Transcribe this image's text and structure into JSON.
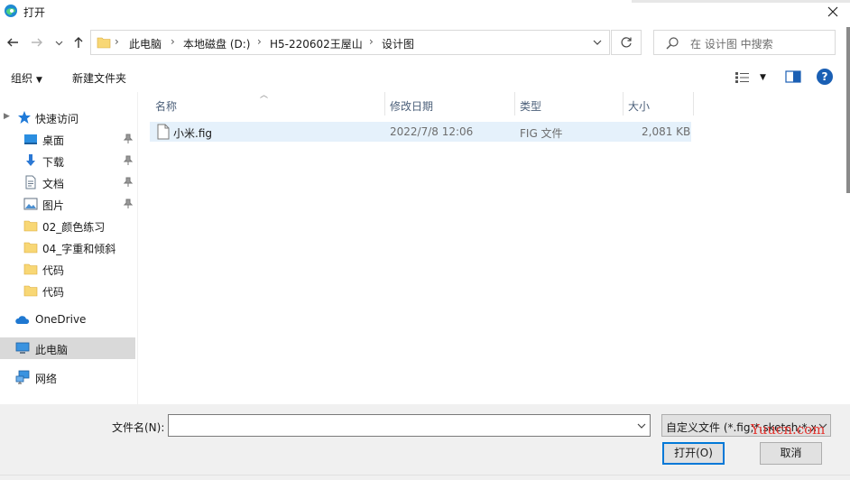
{
  "window": {
    "title": "打开"
  },
  "nav": {
    "breadcrumbs": [
      "此电脑",
      "本地磁盘 (D:)",
      "H5-220602王屋山",
      "设计图"
    ],
    "search_placeholder": "在 设计图 中搜索"
  },
  "toolbar": {
    "organize_label": "组织",
    "new_folder_label": "新建文件夹"
  },
  "sidebar": {
    "items": [
      {
        "label": "快速访问",
        "icon": "star-icon"
      },
      {
        "label": "桌面",
        "icon": "desktop-icon",
        "pinned": true
      },
      {
        "label": "下载",
        "icon": "download-icon",
        "pinned": true
      },
      {
        "label": "文档",
        "icon": "document-icon",
        "pinned": true
      },
      {
        "label": "图片",
        "icon": "picture-icon",
        "pinned": true
      },
      {
        "label": "02_颜色练习",
        "icon": "folder-icon"
      },
      {
        "label": "04_字重和倾斜",
        "icon": "folder-icon"
      },
      {
        "label": "代码",
        "icon": "folder-icon"
      },
      {
        "label": "代码",
        "icon": "folder-icon"
      },
      {
        "label": "OneDrive",
        "icon": "cloud-icon"
      },
      {
        "label": "此电脑",
        "icon": "computer-icon",
        "selected": true
      },
      {
        "label": "网络",
        "icon": "network-icon"
      }
    ]
  },
  "columns": {
    "name": "名称",
    "modified": "修改日期",
    "type": "类型",
    "size": "大小"
  },
  "files": [
    {
      "name": "小米.fig",
      "modified": "2022/7/8 12:06",
      "type": "FIG 文件",
      "size": "2,081 KB"
    }
  ],
  "bottom": {
    "filename_label": "文件名(N):",
    "filename_value": "",
    "filetype_selected": "自定义文件 (*.fig;*.sketch;*.xd",
    "open_label": "打开(O)",
    "cancel_label": "取消",
    "watermark": "Yuucn.com"
  },
  "colors": {
    "accent": "#0078d7",
    "selection": "#e5f1fb",
    "sidebar_selected": "#d9d9d9",
    "folder": "#f8d775"
  }
}
